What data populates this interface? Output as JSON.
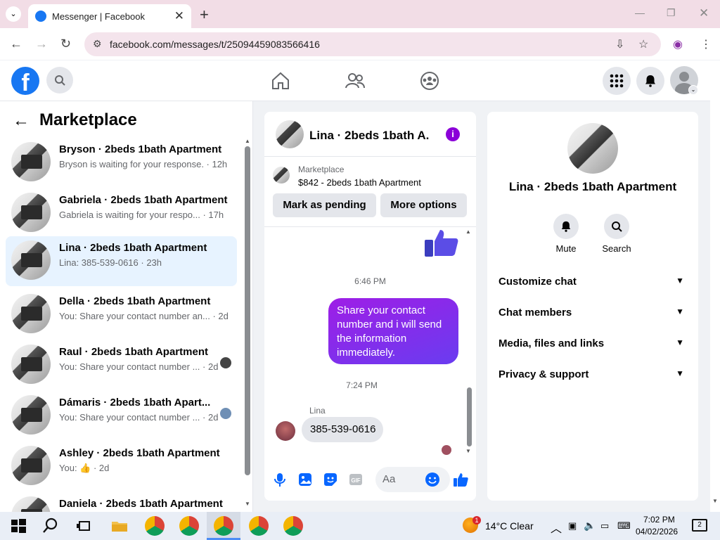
{
  "browser": {
    "tab_title": "Messenger | Facebook",
    "url": "facebook.com/messages/t/25094459083566416"
  },
  "sidebar": {
    "title": "Marketplace",
    "conversations": [
      {
        "name": "Bryson · 2beds 1bath Apartment",
        "snippet": "Bryson is waiting for your response. · 12h",
        "active": false
      },
      {
        "name": "Gabriela · 2beds 1bath Apartment",
        "snippet": "Gabriela is waiting for your respo... · 17h",
        "active": false
      },
      {
        "name": "Lina · 2beds 1bath Apartment",
        "snippet": "Lina: 385-539-0616 · 23h",
        "active": true
      },
      {
        "name": "Della · 2beds 1bath Apartment",
        "snippet": "You: Share your contact number an... · 2d",
        "active": false
      },
      {
        "name": "Raul · 2beds 1bath Apartment",
        "snippet": "You: Share your contact number ... · 2d",
        "active": false
      },
      {
        "name": "Dámaris · 2beds 1bath Apart...",
        "snippet": "You: Share your contact number ... · 2d",
        "active": false
      },
      {
        "name": "Ashley · 2beds 1bath Apartment",
        "snippet": "You: 👍 · 2d",
        "active": false
      },
      {
        "name": "Daniela · 2beds 1bath Apartment",
        "snippet": "",
        "active": false
      }
    ]
  },
  "chat": {
    "title": "Lina · 2beds 1bath A...",
    "marketplace_label": "Marketplace",
    "listing": "$842 - 2beds 1bath Apartment",
    "mark_pending": "Mark as pending",
    "more_options": "More options",
    "time1": "6:46 PM",
    "outgoing": "Share your contact number and i will send the information immediately.",
    "time2": "7:24 PM",
    "sender": "Lina",
    "incoming": "385-539-0616",
    "composer_placeholder": "Aa"
  },
  "details": {
    "name": "Lina · 2beds 1bath Apartment",
    "mute": "Mute",
    "search": "Search",
    "sections": [
      "Customize chat",
      "Chat members",
      "Media, files and links",
      "Privacy & support"
    ]
  },
  "taskbar": {
    "weather": "14°C  Clear",
    "weather_badge": "1",
    "time": "7:02 PM",
    "date": "04/02/2026",
    "notifications": "2"
  },
  "colors": {
    "facebook_blue": "#1877f2",
    "messenger_purple": "#8b00d8",
    "active_row": "#e7f3ff"
  }
}
